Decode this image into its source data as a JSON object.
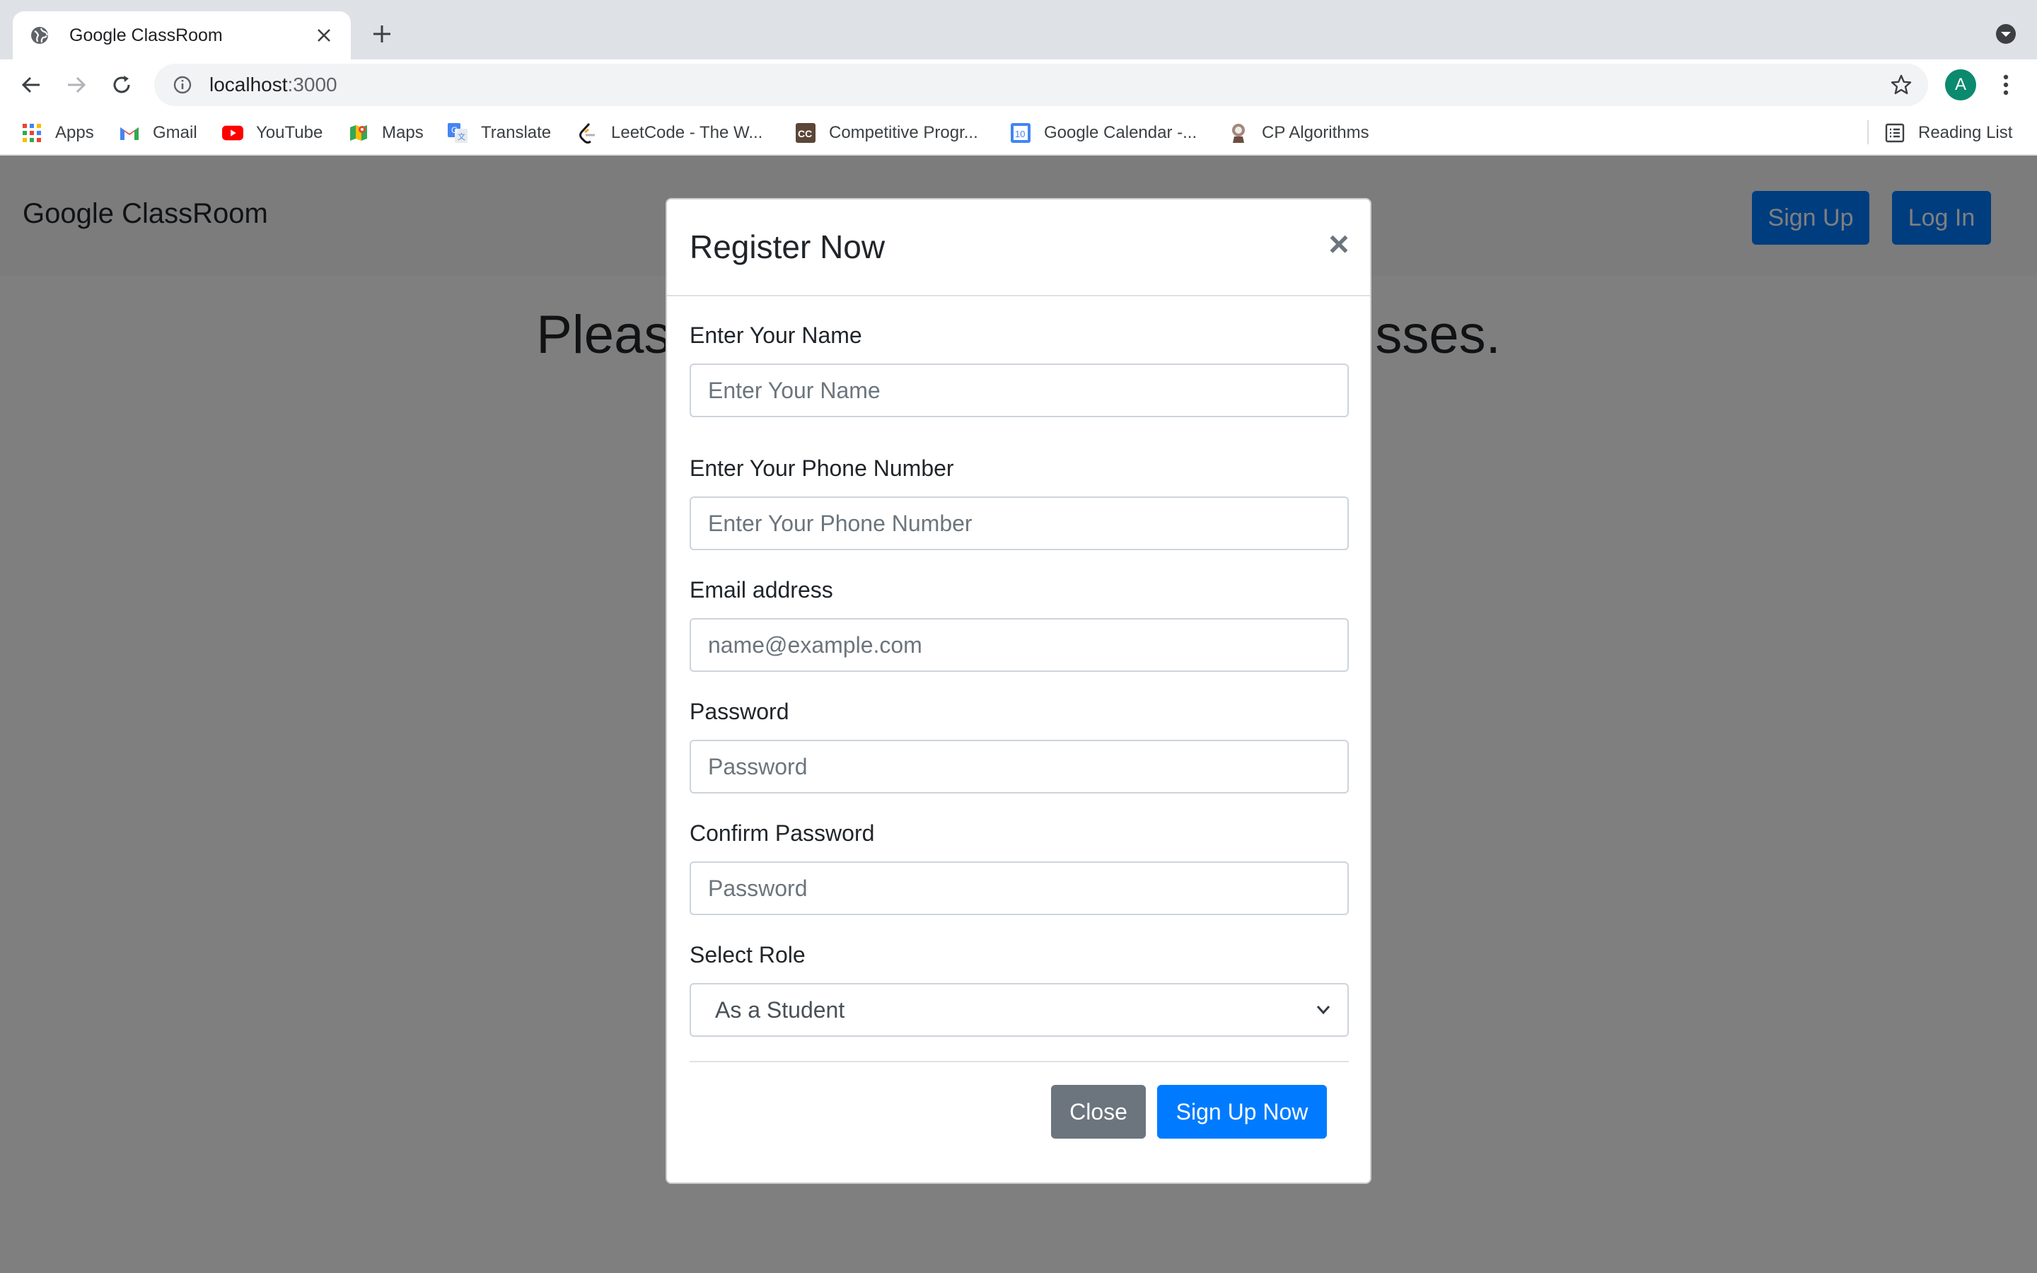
{
  "browser": {
    "tab_title": "Google ClassRoom",
    "url_host": "localhost",
    "url_port": ":3000",
    "profile_initial": "A",
    "bookmarks": [
      {
        "label": "Apps",
        "icon": "apps-grid-icon"
      },
      {
        "label": "Gmail",
        "icon": "gmail-icon"
      },
      {
        "label": "YouTube",
        "icon": "youtube-icon"
      },
      {
        "label": "Maps",
        "icon": "maps-icon"
      },
      {
        "label": "Translate",
        "icon": "translate-icon"
      },
      {
        "label": "LeetCode - The W...",
        "icon": "leetcode-icon"
      },
      {
        "label": "Competitive Progr...",
        "icon": "codechef-icon"
      },
      {
        "label": "Google Calendar -...",
        "icon": "calendar-icon"
      },
      {
        "label": "CP Algorithms",
        "icon": "cp-algorithms-icon"
      }
    ],
    "reading_list": "Reading List"
  },
  "page": {
    "brand": "Google ClassRoom",
    "signup_label": "Sign Up",
    "login_label": "Log In",
    "hero_left": "Pleas",
    "hero_right": "sses."
  },
  "modal": {
    "title": "Register Now",
    "close_glyph": "×",
    "fields": [
      {
        "label": "Enter Your Name",
        "placeholder": "Enter Your Name",
        "type": "text"
      },
      {
        "label": "Enter Your Phone Number",
        "placeholder": "Enter Your Phone Number",
        "type": "text"
      },
      {
        "label": "Email address",
        "placeholder": "name@example.com",
        "type": "email"
      },
      {
        "label": "Password",
        "placeholder": "Password",
        "type": "password"
      },
      {
        "label": "Confirm Password",
        "placeholder": "Password",
        "type": "password"
      }
    ],
    "role": {
      "label": "Select Role",
      "selected": "As a Student"
    },
    "close_button": "Close",
    "submit_button": "Sign Up Now"
  },
  "colors": {
    "primary": "#007bff",
    "secondary": "#6c757d",
    "backdrop": "rgba(0,0,0,0.5)"
  }
}
